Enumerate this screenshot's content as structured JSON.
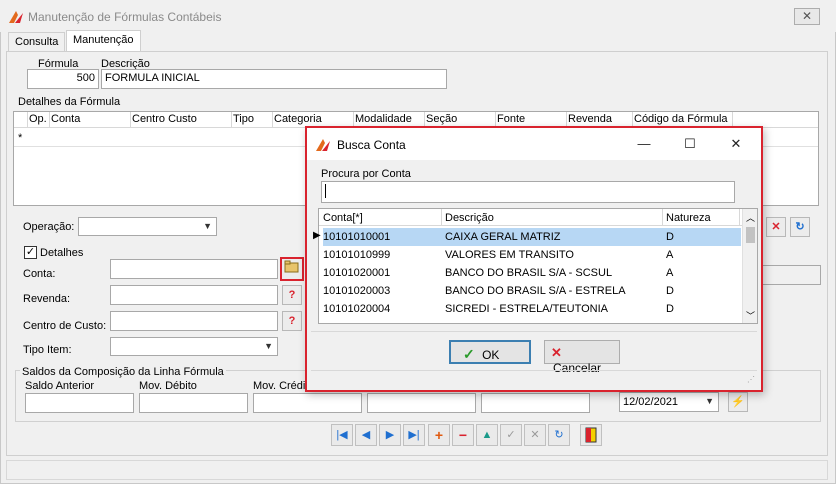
{
  "window": {
    "title": "Manutenção de Fórmulas Contábeis",
    "close_glyph": "✕",
    "app_icon": "app-logo-icon"
  },
  "tabs": [
    {
      "label": "Consulta"
    },
    {
      "label": "Manutenção"
    }
  ],
  "formula": {
    "label_formula": "Fórmula",
    "label_descricao": "Descrição",
    "formula_value": "500",
    "descricao_value": "FORMULA INICIAL"
  },
  "detalhes": {
    "group_label": "Detalhes da Fórmula",
    "columns": [
      "Op.",
      "Conta",
      "Centro Custo",
      "Tipo",
      "Categoria",
      "Modalidade",
      "Seção",
      "Fonte",
      "Revenda",
      "Código da Fórmula"
    ],
    "new_row_marker": "*"
  },
  "form": {
    "operacao_label": "Operação:",
    "detalhes_label": "Detalhes",
    "detalhes_checked": "✓",
    "conta_label": "Conta:",
    "revenda_label": "Revenda:",
    "centro_custo_label": "Centro de Custo:",
    "tipo_item_label": "Tipo Item:"
  },
  "saldos": {
    "group_label": "Saldos da Composição da Linha Fórmula",
    "saldo_anterior": "Saldo Anterior",
    "mov_debito": "Mov. Débito",
    "mov_credito": "Mov. Crédito",
    "date_value": "12/02/2021"
  },
  "dialog": {
    "title": "Busca Conta",
    "search_label": "Procura por Conta",
    "search_value": "",
    "columns": [
      "Conta[*]",
      "Descrição",
      "Natureza"
    ],
    "rows": [
      {
        "conta": "10101010001",
        "descricao": "CAIXA GERAL MATRIZ",
        "natureza": "D"
      },
      {
        "conta": "10101010999",
        "descricao": "VALORES EM TRANSITO",
        "natureza": "A"
      },
      {
        "conta": "10101020001",
        "descricao": "BANCO DO BRASIL S/A - SCSUL",
        "natureza": "A"
      },
      {
        "conta": "10101020003",
        "descricao": "BANCO DO BRASIL S/A - ESTRELA",
        "natureza": "D"
      },
      {
        "conta": "10101020004",
        "descricao": "SICREDI - ESTRELA/TEUTONIA",
        "natureza": "D"
      }
    ],
    "current_row_marker": "▶",
    "ok_label": "OK",
    "cancel_label": "Cancelar"
  },
  "colors": {
    "accent_red": "#d9232e",
    "selection_blue": "#b7d7f4",
    "nav_blue": "#1f6fd0"
  }
}
